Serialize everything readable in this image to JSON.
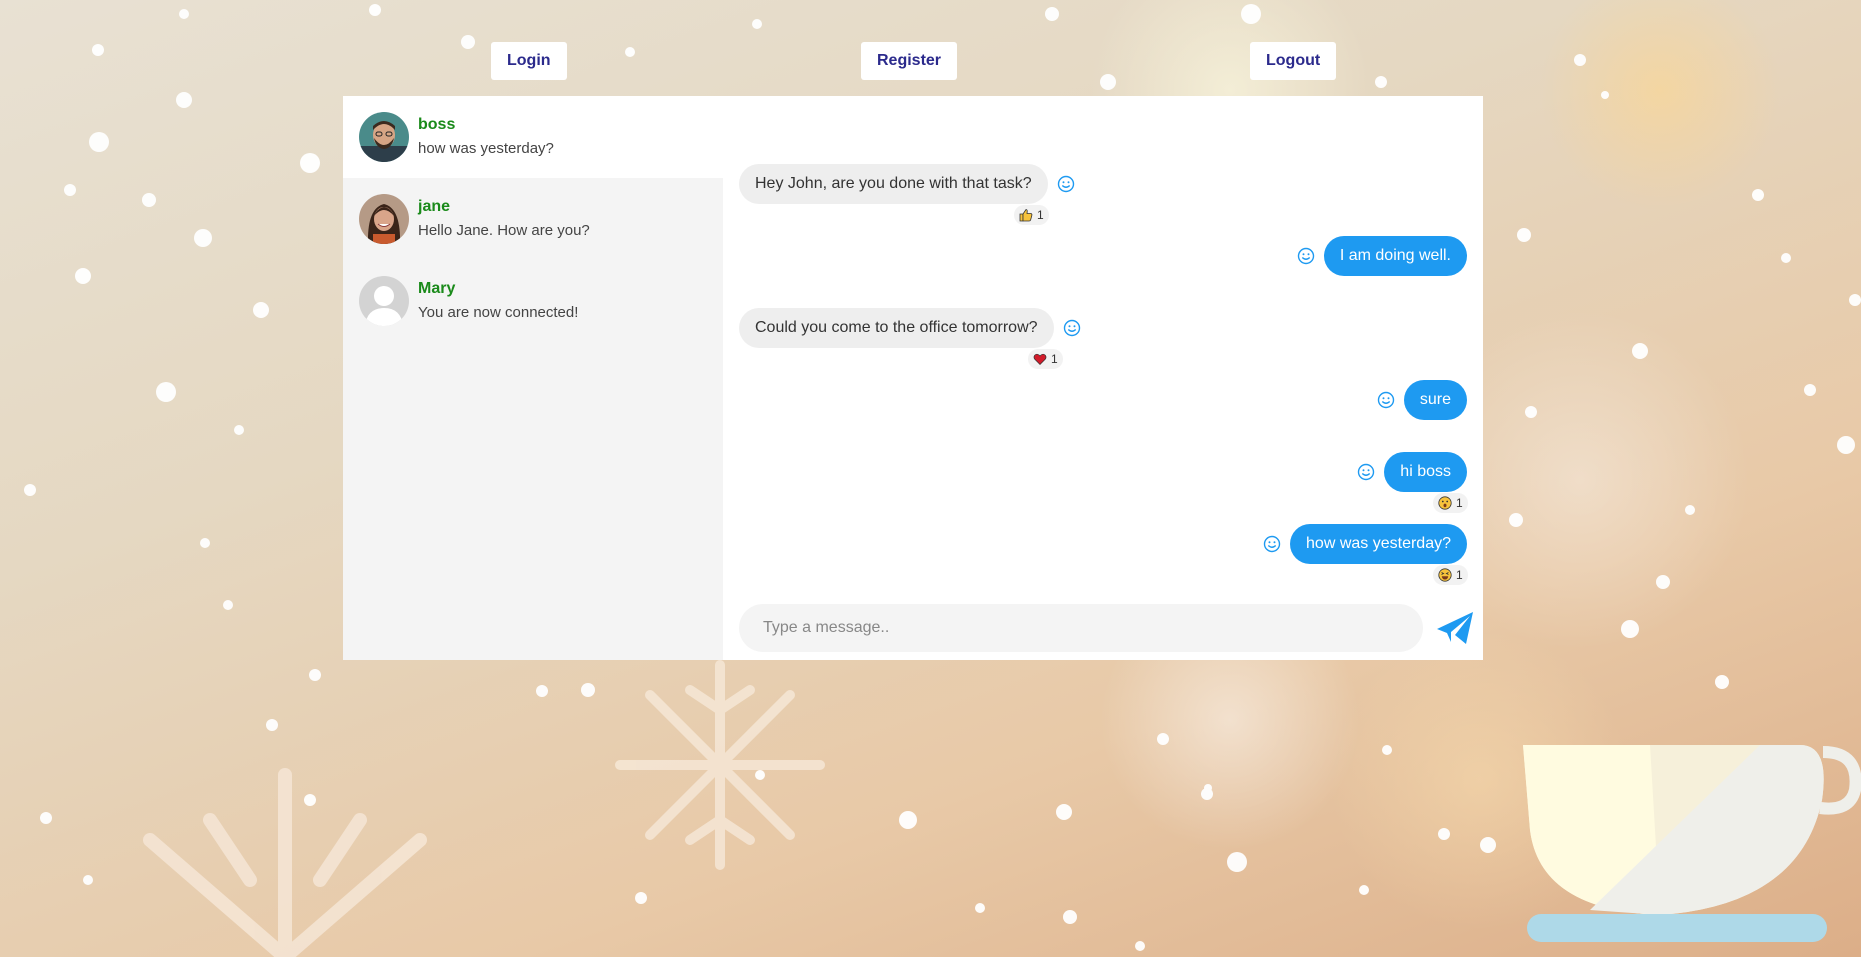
{
  "nav": {
    "login_label": "Login",
    "register_label": "Register",
    "logout_label": "Logout"
  },
  "contacts": [
    {
      "name": "boss",
      "preview": "how was yesterday?",
      "active": true
    },
    {
      "name": "jane",
      "preview": "Hello Jane. How are you?",
      "active": false
    },
    {
      "name": "Mary",
      "preview": "You are now connected!",
      "active": false
    }
  ],
  "messages": [
    {
      "direction": "incoming",
      "text": "Hey John, are you done with that task?",
      "reaction": {
        "emoji": "thumbs-up",
        "count": "1"
      }
    },
    {
      "direction": "outgoing",
      "text": "I am doing well."
    },
    {
      "direction": "incoming",
      "text": "Could you come to the office tomorrow?",
      "reaction": {
        "emoji": "heart",
        "count": "1"
      }
    },
    {
      "direction": "outgoing",
      "text": "sure"
    },
    {
      "direction": "outgoing",
      "text": "hi boss",
      "reaction": {
        "emoji": "surprised-face",
        "count": "1"
      }
    },
    {
      "direction": "outgoing",
      "text": "how was yesterday?",
      "reaction": {
        "emoji": "grinning-squint-face",
        "count": "1"
      }
    }
  ],
  "composer": {
    "placeholder": "Type a message.."
  },
  "colors": {
    "accent": "#1e9af1",
    "contact_name": "#1a8a1a",
    "nav_text": "#2b2a8c"
  }
}
